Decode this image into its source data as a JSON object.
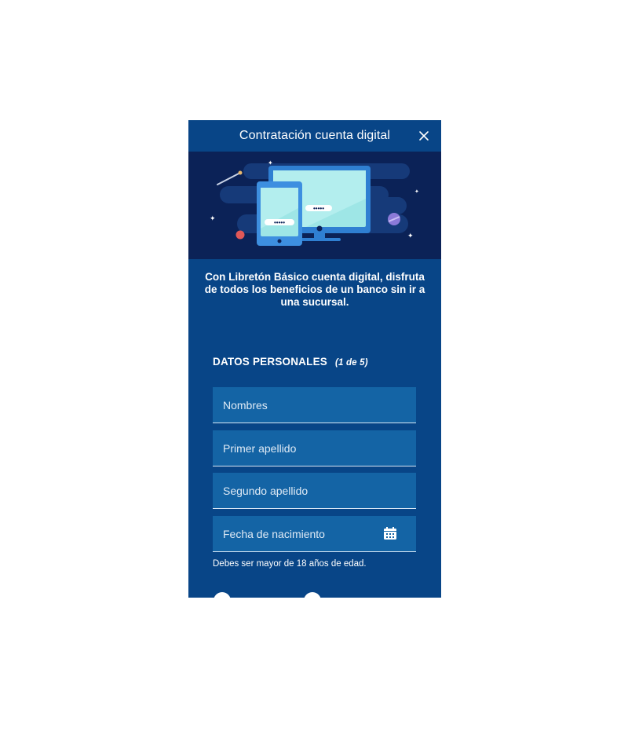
{
  "header": {
    "title": "Contratación cuenta digital",
    "close_icon": "close-icon"
  },
  "hero": {
    "illustration": "devices-illustration",
    "password_mask": "•••••"
  },
  "intro": {
    "text": "Con Libretón Básico cuenta digital, disfruta de todos los beneficios de un banco sin ir a una sucursal."
  },
  "form": {
    "section_title": "DATOS PERSONALES",
    "step": "(1 de 5)",
    "fields": [
      {
        "placeholder": "Nombres"
      },
      {
        "placeholder": "Primer apellido"
      },
      {
        "placeholder": "Segundo apellido"
      },
      {
        "placeholder": "Fecha de nacimiento",
        "icon": "calendar-icon"
      }
    ],
    "hint": "Debes ser mayor de 18 años de edad."
  },
  "colors": {
    "background": "#084587",
    "hero": "#0b2257",
    "field": "#1464a5",
    "text": "#ffffff"
  }
}
